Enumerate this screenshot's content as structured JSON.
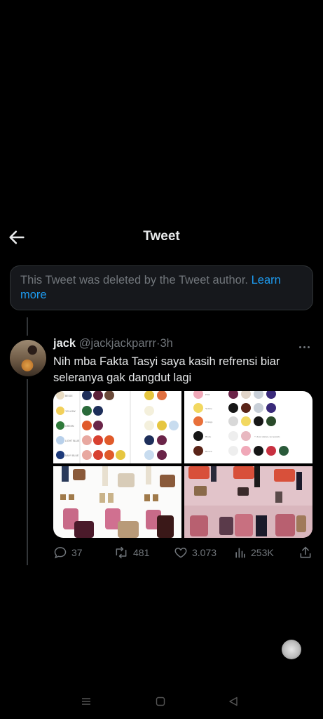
{
  "header": {
    "title": "Tweet"
  },
  "deleted_notice": {
    "text": "This Tweet was deleted by the Tweet author.",
    "link": "Learn more"
  },
  "tweet": {
    "name": "jack",
    "handle": "@jackjackparrr",
    "separator": "·",
    "time": "3h",
    "text": "Nih mba Fakta Tasyi saya kasih refrensi biar seleranya gak dangdut lagi",
    "media": {
      "palette_left_rows": [
        "BEIGE",
        "YELLOW",
        "GREEN",
        "LIGHT BLUE",
        "NAVY BLUE"
      ],
      "palette_right_rows": [
        "Pink",
        "Yellow",
        "Orange",
        "Black",
        "Brown"
      ],
      "palette_right_note": "+ clear shades, not pastels"
    },
    "actions": {
      "replies": "37",
      "retweets": "481",
      "likes": "3.073",
      "views": "253K"
    }
  },
  "colors": {
    "background": "#000000",
    "text": "#e7e9ea",
    "secondary": "#71767b",
    "accent": "#1d9bf0",
    "card": "#16181c"
  }
}
